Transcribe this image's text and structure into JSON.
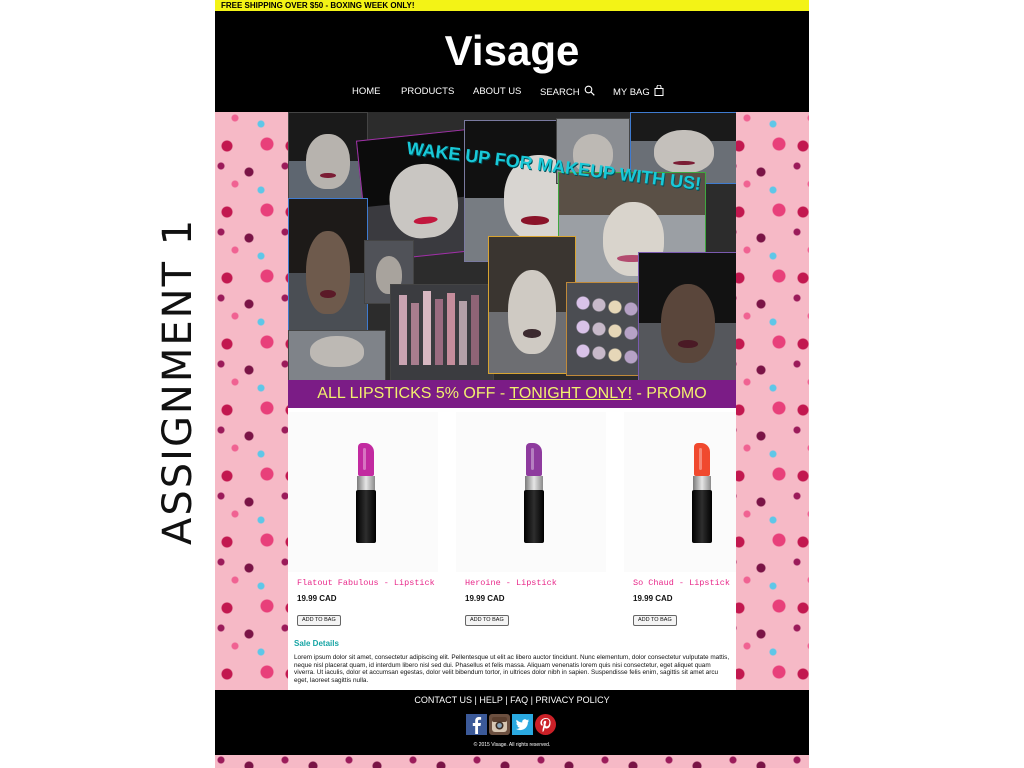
{
  "side_label": "ASSIGNMENT 1",
  "promo_bar": "FREE SHIPPING OVER $50 - BOXING WEEK ONLY!",
  "header": {
    "logo": "Visage",
    "nav": [
      "HOME",
      "PRODUCTS",
      "ABOUT US",
      "SEARCH",
      "MY BAG"
    ]
  },
  "hero": {
    "headline": "WAKE UP FOR MAKEUP WITH US!"
  },
  "banner": {
    "before": "ALL LIPSTICKS 5% OFF - ",
    "highlight": "TONIGHT ONLY!",
    "after": " - PROMO"
  },
  "products": [
    {
      "name": "Flatout Fabulous - Lipstick",
      "price": "19.99 CAD",
      "button": "ADD TO BAG",
      "color": "#c22aa0"
    },
    {
      "name": "Heroine - Lipstick",
      "price": "19.99 CAD",
      "button": "ADD TO BAG",
      "color": "#8e3b9e"
    },
    {
      "name": "So Chaud - Lipstick",
      "price": "19.99 CAD",
      "button": "ADD TO BAG",
      "color": "#f0492e"
    }
  ],
  "sale_details": {
    "title": "Sale Details",
    "body": "Lorem ipsum dolor sit amet, consectetur adipiscing elit. Pellentesque ut elit ac libero auctor tincidunt. Nunc elementum, dolor consectetur vulputate mattis, neque nisl placerat quam, id interdum libero nisl sed dui. Phasellus et felis massa. Aliquam venenatis lorem quis nisi consectetur, eget aliquet quam viverra. Ut iaculis, dolor et accumsan egestas, dolor velit bibendum tortor, in ultrices dolor nibh in sapien. Suspendisse felis enim, sagittis sit amet arcu eget, laoreet sagittis nulla."
  },
  "footer": {
    "links": [
      "CONTACT US",
      "HELP",
      "FAQ",
      "PRIVACY POLICY"
    ],
    "copyright": "© 2015 Visage. All rights reserved."
  },
  "colors": {
    "promo_bar": "#f3f316",
    "banner": "#7b1c86",
    "banner_text": "#f2f06e",
    "product_name": "#e8298a",
    "details_title": "#17a5a5"
  }
}
